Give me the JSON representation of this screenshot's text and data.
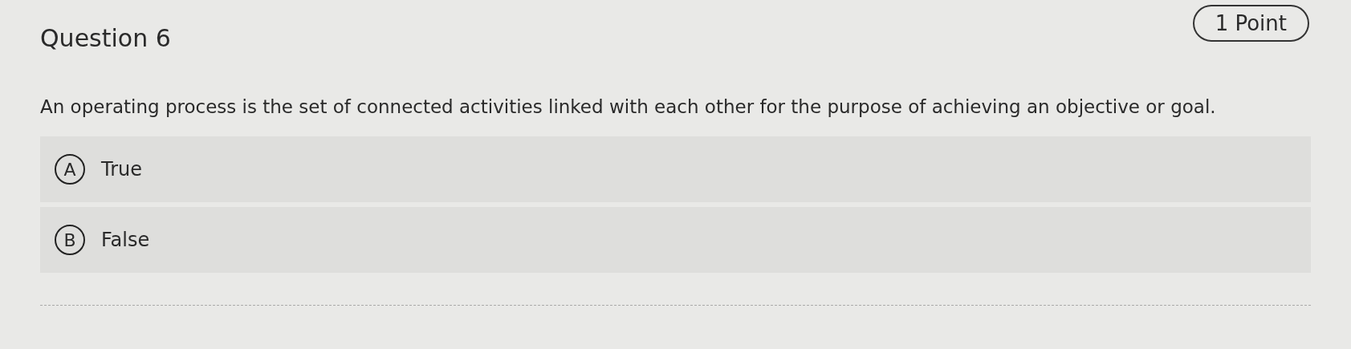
{
  "question": {
    "title": "Question 6",
    "points": "1 Point",
    "text": "An operating process is the set of connected activities linked with each other for the purpose of achieving an objective or goal."
  },
  "options": [
    {
      "letter": "A",
      "label": "True"
    },
    {
      "letter": "B",
      "label": "False"
    }
  ]
}
